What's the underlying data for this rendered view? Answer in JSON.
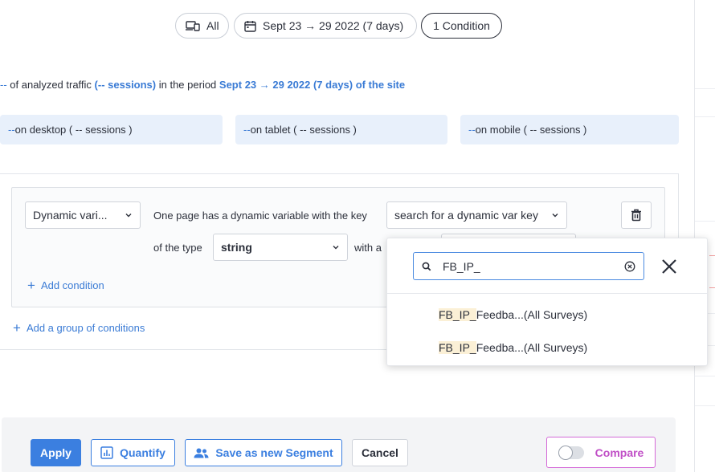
{
  "filters": {
    "device_label": "All",
    "date_label": "Sept 23 → 29 2022 (7 days)",
    "condition_label": "1 Condition"
  },
  "traffic": {
    "prefix_dash": "--",
    "text1": " of analyzed traffic ",
    "sessions": "(-- sessions)",
    "text2": " in the period ",
    "period": "Sept 23 → 29 2022 (7 days) of the site"
  },
  "devices": [
    {
      "dash": "--",
      "text": " on desktop ( -- sessions )"
    },
    {
      "dash": "--",
      "text": " on tablet ( -- sessions )"
    },
    {
      "dash": "--",
      "text": " on mobile ( -- sessions )"
    }
  ],
  "condition": {
    "type_select": "Dynamic vari...",
    "sentence_start": "One page has a dynamic variable with the key",
    "key_placeholder": "search for a dynamic var key",
    "of_type_label": "of the type",
    "type_value": "string",
    "with_label": "with a",
    "add_condition": "Add condition",
    "add_group": "Add a group of conditions"
  },
  "dropdown": {
    "search_value": "FB_IP_",
    "options": [
      {
        "match": "FB_IP_",
        "rest": "Feedba...(All Surveys)"
      },
      {
        "match": "FB_IP_",
        "rest": "Feedba...(All Surveys)"
      }
    ]
  },
  "actions": {
    "apply": "Apply",
    "quantify": "Quantify",
    "save_segment": "Save as new Segment",
    "cancel": "Cancel",
    "compare": "Compare",
    "compare_enabled": false
  },
  "colors": {
    "accent": "#3b7fe0",
    "compare": "#c04fc6",
    "highlight": "#fbf0d6"
  }
}
